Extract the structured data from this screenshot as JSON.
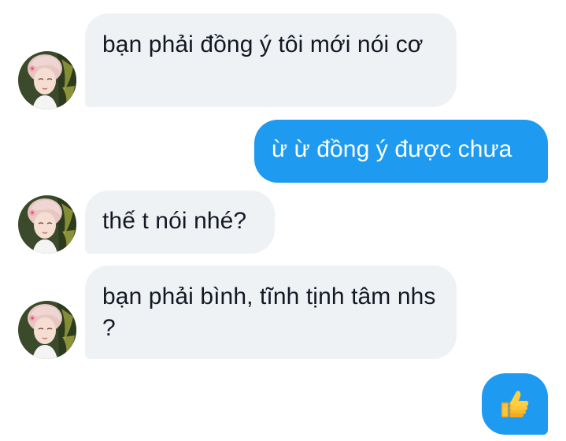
{
  "messages": [
    {
      "id": "msg1",
      "sender": "them",
      "text": "bạn phải đồng ý tôi mới nói cơ"
    },
    {
      "id": "msg2",
      "sender": "me",
      "text": "ừ ừ đồng ý được chưa"
    },
    {
      "id": "msg3",
      "sender": "them",
      "text": "thế t nói nhé?"
    },
    {
      "id": "msg4",
      "sender": "them",
      "text": "bạn phải bình, tĩnh tịnh tâm nhs ?"
    },
    {
      "id": "msg5",
      "sender": "me",
      "icon": "thumbs-up-emoji"
    }
  ],
  "colors": {
    "incoming_bubble": "#eff2f5",
    "outgoing_bubble": "#1e9bf0",
    "incoming_text": "#141823",
    "outgoing_text": "#ffffff"
  },
  "avatar": {
    "icon": "contact-avatar"
  }
}
